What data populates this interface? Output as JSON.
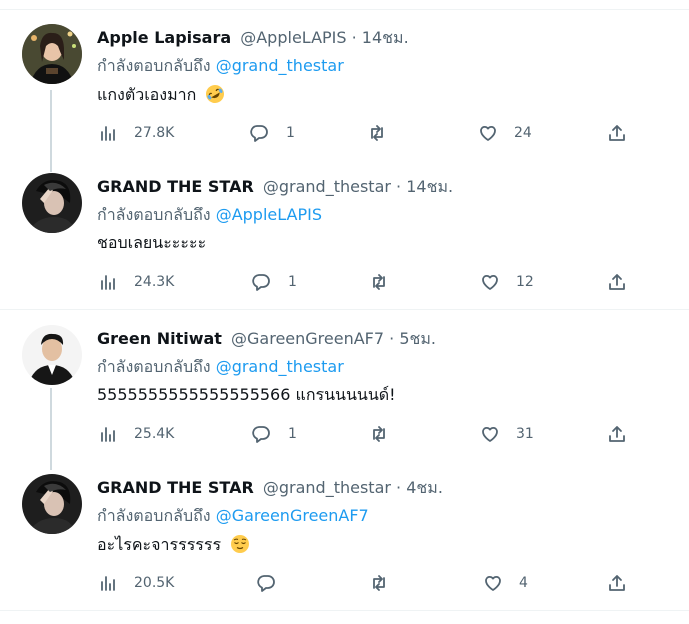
{
  "replying_to_label": "กำลังตอบกลับถึง",
  "tweets": [
    {
      "name": "Apple Lapisara",
      "handle": "@AppleLAPIS",
      "separator": " · ",
      "time": "14ชม.",
      "reply_to": "@grand_thestar",
      "text": "แกงตัวเองมาก",
      "emoji": "rolling-on-floor-laughing-emoji",
      "views": "27.8K",
      "replies": "1",
      "retweets": "",
      "likes": "24"
    },
    {
      "name": "GRAND THE STAR",
      "handle": "@grand_thestar",
      "separator": " · ",
      "time": "14ชม.",
      "reply_to": "@AppleLAPIS",
      "text": "ชอบเลยนะะะะะ",
      "views": "24.3K",
      "replies": "1",
      "retweets": "",
      "likes": "12"
    },
    {
      "name": "Green Nitiwat",
      "handle": "@GareenGreenAF7",
      "separator": " · ",
      "time": "5ชม.",
      "reply_to": "@grand_thestar",
      "text": "5555555555555555566 แกรนนนนนด์!",
      "views": "25.4K",
      "replies": "1",
      "retweets": "",
      "likes": "31"
    },
    {
      "name": "GRAND THE STAR",
      "handle": "@grand_thestar",
      "separator": " · ",
      "time": "4ชม.",
      "reply_to": "@GareenGreenAF7",
      "text": "อะไรคะจารรรรรร",
      "emoji": "relieved-face-emoji",
      "views": "20.5K",
      "replies": "",
      "retweets": "",
      "likes": "4"
    }
  ],
  "colors": {
    "link": "#1d9bf0",
    "secondary_text": "#536471",
    "primary_text": "#0f1419",
    "thread_line": "#cfd9de",
    "divider": "#eff3f4"
  }
}
